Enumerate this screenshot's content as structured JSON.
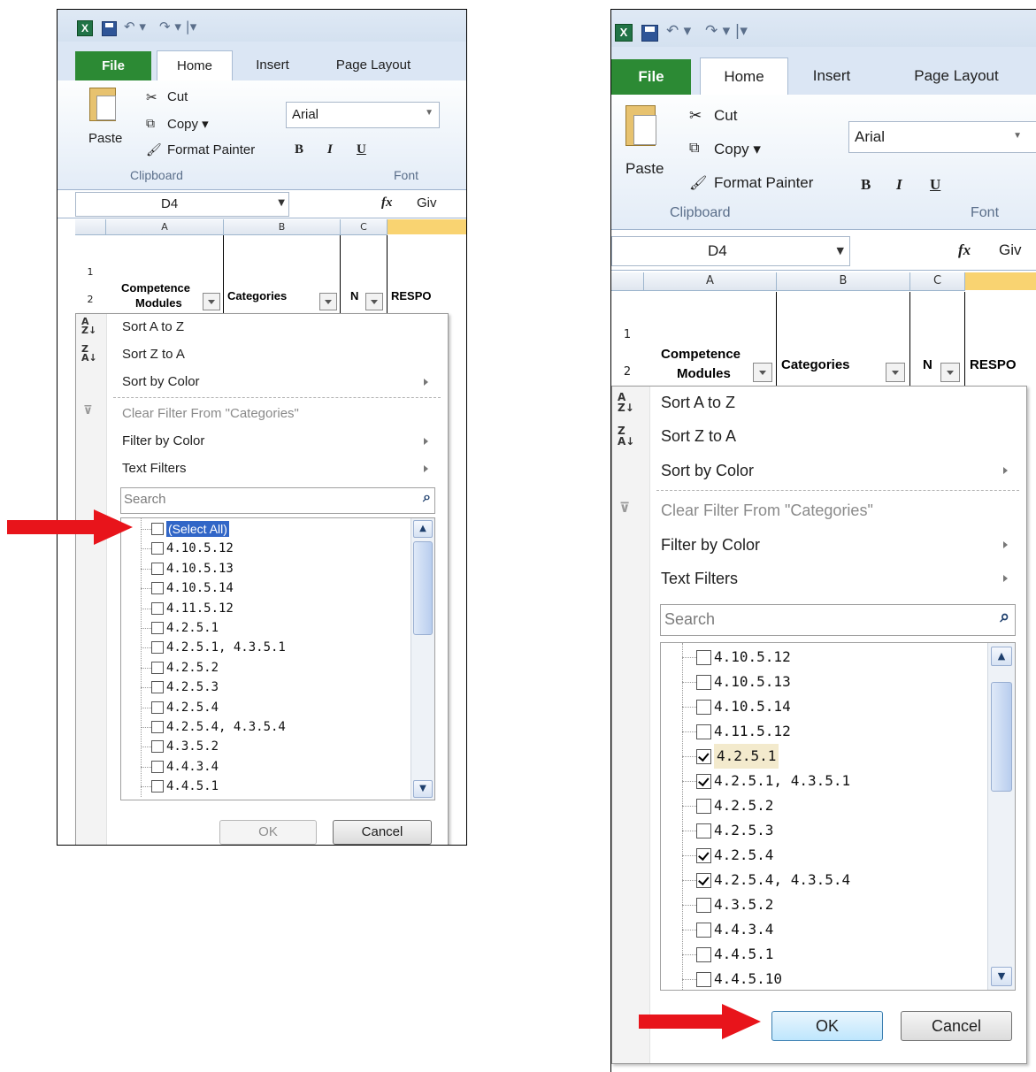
{
  "app": {
    "tabs": {
      "file": "File",
      "home": "Home",
      "insert": "Insert",
      "page_layout": "Page Layout"
    },
    "clipboard": {
      "paste": "Paste",
      "cut": "Cut",
      "copy": "Copy ▾",
      "format_painter": "Format Painter",
      "group_label": "Clipboard"
    },
    "font": {
      "name": "Arial",
      "bold": "B",
      "italic": "I",
      "underline": "U",
      "group_label": "Font"
    },
    "formula_bar": {
      "name_box": "D4",
      "fx": "fx",
      "content": "Giv"
    },
    "columns": [
      "A",
      "B",
      "C"
    ],
    "rows": [
      "1",
      "2"
    ],
    "headers": {
      "col_a_line1": "Competence",
      "col_a_line2": "Modules",
      "col_b": "Categories",
      "col_c": "N",
      "col_d": "RESPO"
    }
  },
  "filter_menu": {
    "sort_a_z": "Sort A to Z",
    "sort_z_a": "Sort Z to A",
    "sort_by_color": "Sort by Color",
    "clear_filter": "Clear Filter From \"Categories\"",
    "filter_by_color": "Filter by Color",
    "text_filters": "Text Filters",
    "search_placeholder": "Search",
    "ok": "OK",
    "cancel": "Cancel"
  },
  "left_list": [
    {
      "label": "(Select All)",
      "checked": false
    },
    {
      "label": "4.10.5.12",
      "checked": false
    },
    {
      "label": "4.10.5.13",
      "checked": false
    },
    {
      "label": "4.10.5.14",
      "checked": false
    },
    {
      "label": "4.11.5.12",
      "checked": false
    },
    {
      "label": "4.2.5.1",
      "checked": false
    },
    {
      "label": "4.2.5.1, 4.3.5.1",
      "checked": false
    },
    {
      "label": "4.2.5.2",
      "checked": false
    },
    {
      "label": "4.2.5.3",
      "checked": false
    },
    {
      "label": "4.2.5.4",
      "checked": false
    },
    {
      "label": "4.2.5.4, 4.3.5.4",
      "checked": false
    },
    {
      "label": "4.3.5.2",
      "checked": false
    },
    {
      "label": "4.4.3.4",
      "checked": false
    },
    {
      "label": "4.4.5.1",
      "checked": false
    }
  ],
  "right_list": [
    {
      "label": "4.10.5.12",
      "checked": false
    },
    {
      "label": "4.10.5.13",
      "checked": false
    },
    {
      "label": "4.10.5.14",
      "checked": false
    },
    {
      "label": "4.11.5.12",
      "checked": false
    },
    {
      "label": "4.2.5.1",
      "checked": true
    },
    {
      "label": "4.2.5.1, 4.3.5.1",
      "checked": true
    },
    {
      "label": "4.2.5.2",
      "checked": false
    },
    {
      "label": "4.2.5.3",
      "checked": false
    },
    {
      "label": "4.2.5.4",
      "checked": true
    },
    {
      "label": "4.2.5.4, 4.3.5.4",
      "checked": true
    },
    {
      "label": "4.3.5.2",
      "checked": false
    },
    {
      "label": "4.4.3.4",
      "checked": false
    },
    {
      "label": "4.4.5.1",
      "checked": false
    },
    {
      "label": "4.4.5.10",
      "checked": false
    }
  ],
  "colors": {
    "annotation_arrow": "#e8141b",
    "file_tab": "#2c8a34",
    "selection": "#3166c7"
  }
}
